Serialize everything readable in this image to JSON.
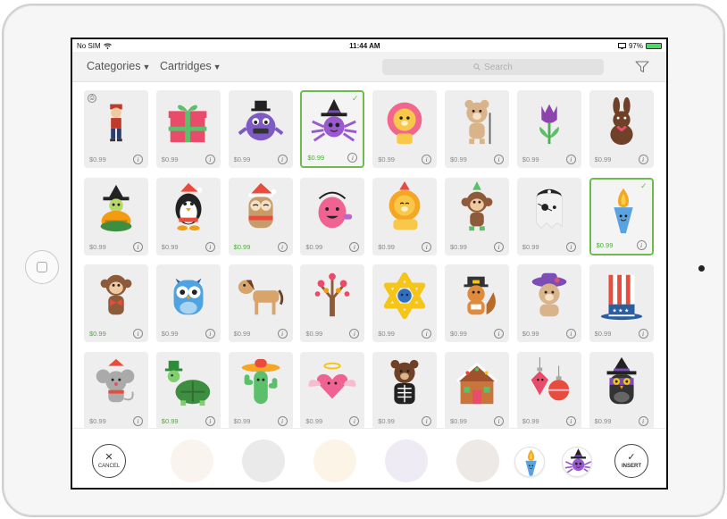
{
  "status": {
    "carrier": "No SIM",
    "time": "11:44 AM",
    "battery": "97%",
    "battery_level": 0.97
  },
  "toolbar": {
    "categories_label": "Categories",
    "cartridges_label": "Cartridges",
    "search_placeholder": "Search"
  },
  "bottom": {
    "cancel_label": "CANCEL",
    "insert_label": "INSERT",
    "picked_items": [
      "torch",
      "witch-spider"
    ]
  },
  "colors": {
    "selected_border": "#6dbd4e",
    "tile_bg": "#eeeeee",
    "price_green": "#4caf3a"
  },
  "images": [
    {
      "name": "pirate",
      "price": "$0.99",
      "selected": false,
      "green": false,
      "locked": true
    },
    {
      "name": "gift",
      "price": "$0.99",
      "selected": false,
      "green": false
    },
    {
      "name": "purple-monster",
      "price": "$0.99",
      "selected": false,
      "green": false
    },
    {
      "name": "witch-spider",
      "price": "$0.99",
      "selected": true,
      "green": true
    },
    {
      "name": "lion-pink",
      "price": "$0.99",
      "selected": false,
      "green": false
    },
    {
      "name": "teddy-golf",
      "price": "$0.99",
      "selected": false,
      "green": false
    },
    {
      "name": "tulip",
      "price": "$0.99",
      "selected": false,
      "green": false
    },
    {
      "name": "chocolate-bunny",
      "price": "$0.99",
      "selected": false,
      "green": false
    },
    {
      "name": "witch-turtle",
      "price": "$0.99",
      "selected": false,
      "green": false
    },
    {
      "name": "santa-penguin",
      "price": "$0.99",
      "selected": false,
      "green": false
    },
    {
      "name": "santa-owl",
      "price": "$0.99",
      "selected": false,
      "green": true
    },
    {
      "name": "trick-or-treat-bucket",
      "price": "$0.99",
      "selected": false,
      "green": false
    },
    {
      "name": "party-lion",
      "price": "$0.99",
      "selected": false,
      "green": false
    },
    {
      "name": "party-monkey",
      "price": "$0.99",
      "selected": false,
      "green": false
    },
    {
      "name": "pirate-ghost",
      "price": "$0.99",
      "selected": false,
      "green": false
    },
    {
      "name": "torch",
      "price": "$0.99",
      "selected": true,
      "green": true
    },
    {
      "name": "monkey-bowtie",
      "price": "$0.99",
      "selected": false,
      "green": true
    },
    {
      "name": "blue-owl",
      "price": "$0.99",
      "selected": false,
      "green": false
    },
    {
      "name": "horse",
      "price": "$0.99",
      "selected": false,
      "green": false
    },
    {
      "name": "heart-tree",
      "price": "$0.99",
      "selected": false,
      "green": false
    },
    {
      "name": "star-of-david",
      "price": "$0.99",
      "selected": false,
      "green": false
    },
    {
      "name": "pilgrim-squirrel",
      "price": "$0.99",
      "selected": false,
      "green": false
    },
    {
      "name": "bear-hat",
      "price": "$0.99",
      "selected": false,
      "green": false
    },
    {
      "name": "uncle-sam-hat",
      "price": "$0.99",
      "selected": false,
      "green": false
    },
    {
      "name": "santa-mouse",
      "price": "$0.99",
      "selected": false,
      "green": false
    },
    {
      "name": "leprechaun-turtle",
      "price": "$0.99",
      "selected": false,
      "green": true
    },
    {
      "name": "sombrero-cactus",
      "price": "$0.99",
      "selected": false,
      "green": false
    },
    {
      "name": "angel-heart",
      "price": "$0.99",
      "selected": false,
      "green": false
    },
    {
      "name": "skeleton-bear",
      "price": "$0.99",
      "selected": false,
      "green": false
    },
    {
      "name": "gingerbread-house",
      "price": "$0.99",
      "selected": false,
      "green": false
    },
    {
      "name": "ornaments",
      "price": "$0.99",
      "selected": false,
      "green": false
    },
    {
      "name": "witch-owl",
      "price": "$0.99",
      "selected": false,
      "green": false
    }
  ]
}
